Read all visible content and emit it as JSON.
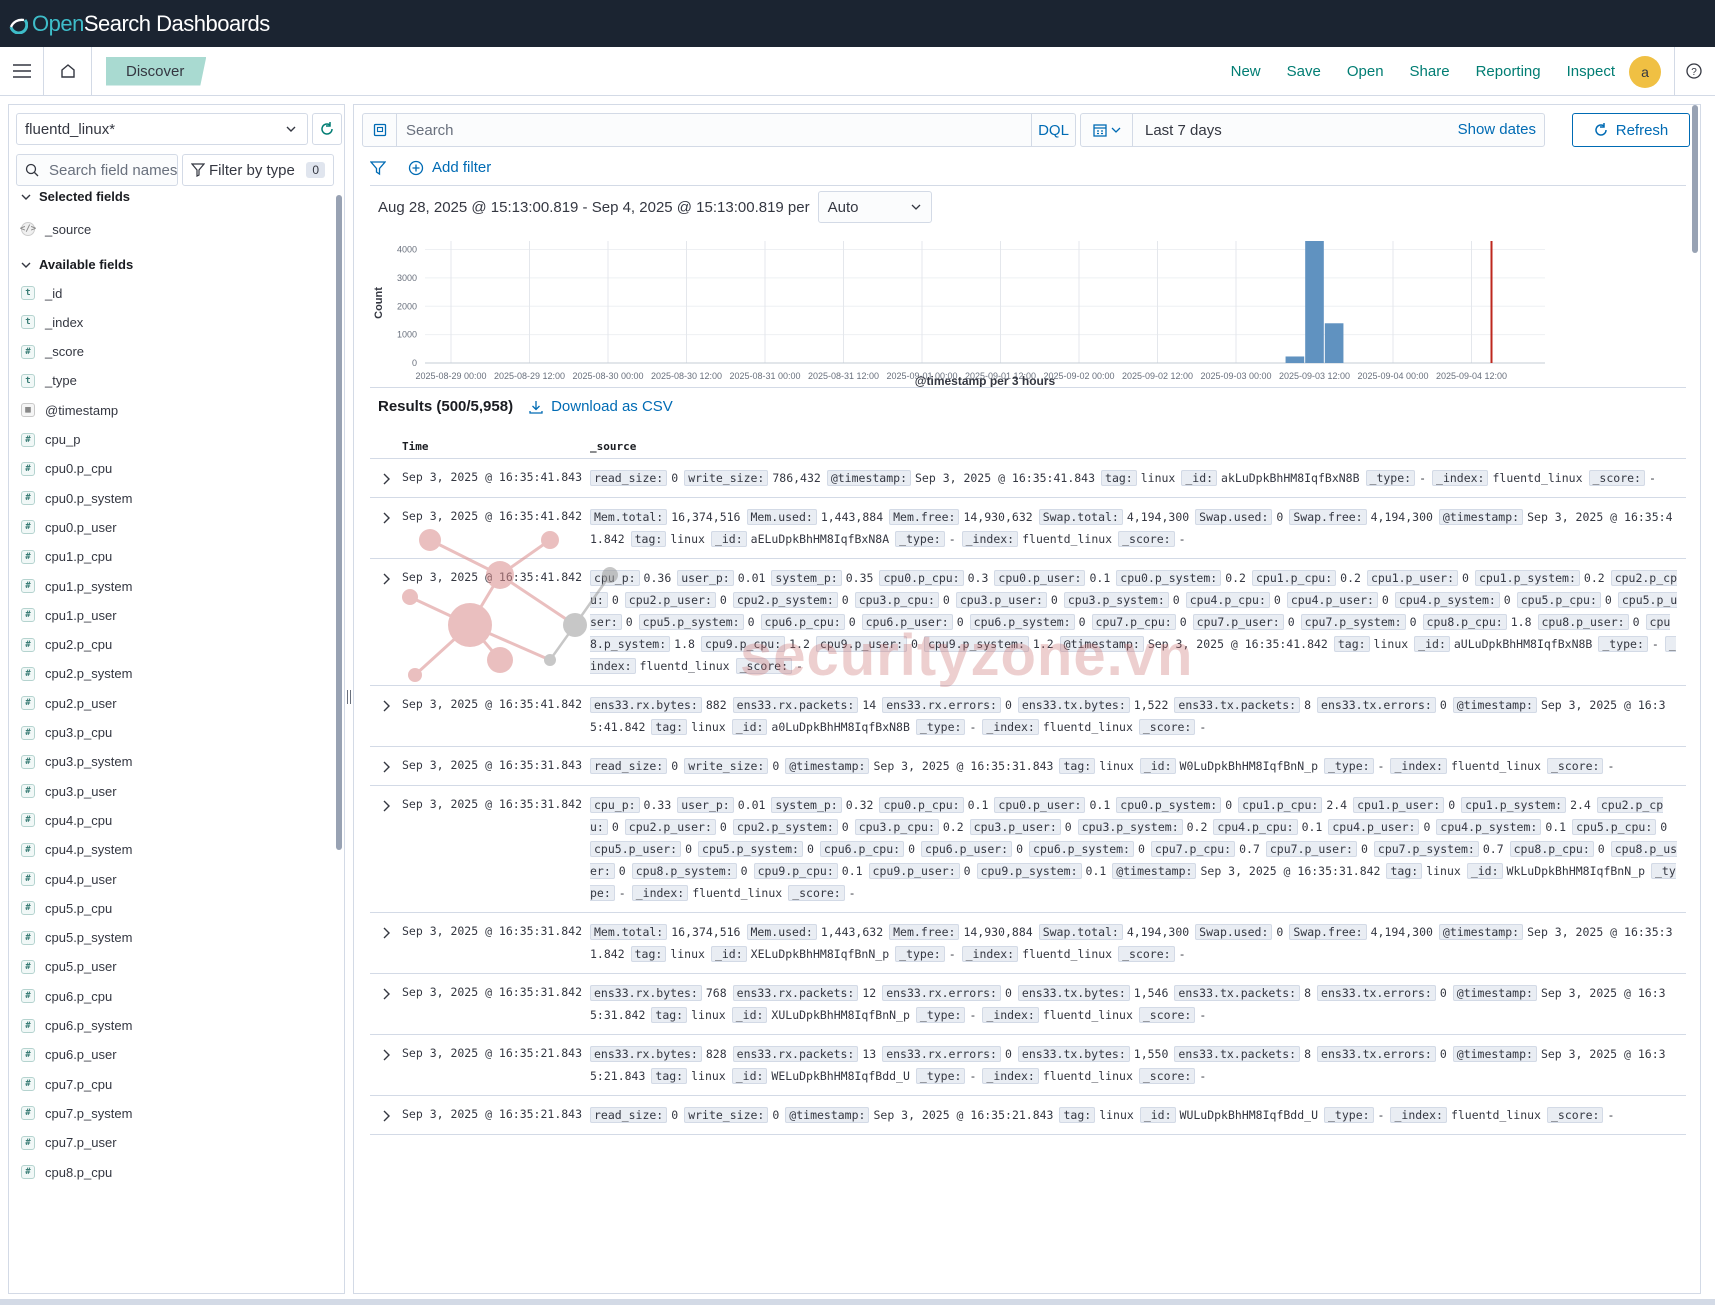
{
  "app": {
    "logo_open": "Open",
    "logo_rest": "Search Dashboards"
  },
  "nav": {
    "breadcrumb": "Discover",
    "links": [
      "New",
      "Save",
      "Open",
      "Share",
      "Reporting",
      "Inspect"
    ],
    "avatar": "a"
  },
  "sidebar": {
    "index_pattern": "fluentd_linux*",
    "search_placeholder": "Search field names",
    "filter_by_type": "Filter by type",
    "filter_count": "0",
    "selected_title": "Selected fields",
    "selected_fields": [
      {
        "name": "_source",
        "type": "source"
      }
    ],
    "available_title": "Available fields",
    "available_fields": [
      {
        "name": "_id",
        "type": "t"
      },
      {
        "name": "_index",
        "type": "t"
      },
      {
        "name": "_score",
        "type": "#"
      },
      {
        "name": "_type",
        "type": "t"
      },
      {
        "name": "@timestamp",
        "type": "date"
      },
      {
        "name": "cpu_p",
        "type": "#"
      },
      {
        "name": "cpu0.p_cpu",
        "type": "#"
      },
      {
        "name": "cpu0.p_system",
        "type": "#"
      },
      {
        "name": "cpu0.p_user",
        "type": "#"
      },
      {
        "name": "cpu1.p_cpu",
        "type": "#"
      },
      {
        "name": "cpu1.p_system",
        "type": "#"
      },
      {
        "name": "cpu1.p_user",
        "type": "#"
      },
      {
        "name": "cpu2.p_cpu",
        "type": "#"
      },
      {
        "name": "cpu2.p_system",
        "type": "#"
      },
      {
        "name": "cpu2.p_user",
        "type": "#"
      },
      {
        "name": "cpu3.p_cpu",
        "type": "#"
      },
      {
        "name": "cpu3.p_system",
        "type": "#"
      },
      {
        "name": "cpu3.p_user",
        "type": "#"
      },
      {
        "name": "cpu4.p_cpu",
        "type": "#"
      },
      {
        "name": "cpu4.p_system",
        "type": "#"
      },
      {
        "name": "cpu4.p_user",
        "type": "#"
      },
      {
        "name": "cpu5.p_cpu",
        "type": "#"
      },
      {
        "name": "cpu5.p_system",
        "type": "#"
      },
      {
        "name": "cpu5.p_user",
        "type": "#"
      },
      {
        "name": "cpu6.p_cpu",
        "type": "#"
      },
      {
        "name": "cpu6.p_system",
        "type": "#"
      },
      {
        "name": "cpu6.p_user",
        "type": "#"
      },
      {
        "name": "cpu7.p_cpu",
        "type": "#"
      },
      {
        "name": "cpu7.p_system",
        "type": "#"
      },
      {
        "name": "cpu7.p_user",
        "type": "#"
      },
      {
        "name": "cpu8.p_cpu",
        "type": "#"
      }
    ]
  },
  "query": {
    "placeholder": "Search",
    "language": "DQL",
    "time_range": "Last 7 days",
    "show_dates": "Show dates",
    "refresh": "Refresh",
    "add_filter": "Add filter"
  },
  "histogram": {
    "range_text": "Aug 28, 2025 @ 15:13:00.819 - Sep 4, 2025 @ 15:13:00.819 per",
    "interval": "Auto"
  },
  "chart_data": {
    "type": "bar",
    "title": "",
    "xlabel": "@timestamp per 3 hours",
    "ylabel": "Count",
    "ylim": [
      0,
      4300
    ],
    "yticks": [
      0,
      1000,
      2000,
      3000,
      4000
    ],
    "xticks": [
      "2025-08-29 00:00",
      "2025-08-29 12:00",
      "2025-08-30 00:00",
      "2025-08-30 12:00",
      "2025-08-31 00:00",
      "2025-08-31 12:00",
      "2025-09-01 00:00",
      "2025-09-01 12:00",
      "2025-09-02 00:00",
      "2025-09-02 12:00",
      "2025-09-03 00:00",
      "2025-09-03 12:00",
      "2025-09-04 00:00",
      "2025-09-04 12:00"
    ],
    "bars": [
      {
        "x": "2025-09-03 09:00",
        "value": 230
      },
      {
        "x": "2025-09-03 12:00",
        "value": 4300
      },
      {
        "x": "2025-09-03 15:00",
        "value": 1400
      }
    ],
    "color": "#6092c0",
    "now_marker_color": "#bd271e",
    "grid": true
  },
  "results": {
    "title": "Results (500/5,958)",
    "download": "Download as CSV",
    "col_time": "Time",
    "col_source": "_source",
    "rows": [
      {
        "time": "Sep 3, 2025 @ 16:35:41.843",
        "fields": [
          [
            "read_size:",
            "0"
          ],
          [
            "write_size:",
            "786,432"
          ],
          [
            "@timestamp:",
            "Sep 3, 2025 @ 16:35:41.843"
          ],
          [
            "tag:",
            "linux"
          ],
          [
            "_id:",
            "akLuDpkBhHM8IqfBxN8B"
          ],
          [
            "_type:",
            "-"
          ],
          [
            "_index:",
            "fluentd_linux"
          ],
          [
            "_score:",
            "-"
          ]
        ]
      },
      {
        "time": "Sep 3, 2025 @ 16:35:41.842",
        "fields": [
          [
            "Mem.total:",
            "16,374,516"
          ],
          [
            "Mem.used:",
            "1,443,884"
          ],
          [
            "Mem.free:",
            "14,930,632"
          ],
          [
            "Swap.total:",
            "4,194,300"
          ],
          [
            "Swap.used:",
            "0"
          ],
          [
            "Swap.free:",
            "4,194,300"
          ],
          [
            "@timestamp:",
            "Sep 3, 2025 @ 16:35:41.842"
          ],
          [
            "tag:",
            "linux"
          ],
          [
            "_id:",
            "aELuDpkBhHM8IqfBxN8A"
          ],
          [
            "_type:",
            "-"
          ],
          [
            "_index:",
            "fluentd_linux"
          ],
          [
            "_score:",
            "-"
          ]
        ]
      },
      {
        "time": "Sep 3, 2025 @ 16:35:41.842",
        "fields": [
          [
            "cpu_p:",
            "0.36"
          ],
          [
            "user_p:",
            "0.01"
          ],
          [
            "system_p:",
            "0.35"
          ],
          [
            "cpu0.p_cpu:",
            "0.3"
          ],
          [
            "cpu0.p_user:",
            "0.1"
          ],
          [
            "cpu0.p_system:",
            "0.2"
          ],
          [
            "cpu1.p_cpu:",
            "0.2"
          ],
          [
            "cpu1.p_user:",
            "0"
          ],
          [
            "cpu1.p_system:",
            "0.2"
          ],
          [
            "cpu2.p_cpu:",
            "0"
          ],
          [
            "cpu2.p_user:",
            "0"
          ],
          [
            "cpu2.p_system:",
            "0"
          ],
          [
            "cpu3.p_cpu:",
            "0"
          ],
          [
            "cpu3.p_user:",
            "0"
          ],
          [
            "cpu3.p_system:",
            "0"
          ],
          [
            "cpu4.p_cpu:",
            "0"
          ],
          [
            "cpu4.p_user:",
            "0"
          ],
          [
            "cpu4.p_system:",
            "0"
          ],
          [
            "cpu5.p_cpu:",
            "0"
          ],
          [
            "cpu5.p_user:",
            "0"
          ],
          [
            "cpu5.p_system:",
            "0"
          ],
          [
            "cpu6.p_cpu:",
            "0"
          ],
          [
            "cpu6.p_user:",
            "0"
          ],
          [
            "cpu6.p_system:",
            "0"
          ],
          [
            "cpu7.p_cpu:",
            "0"
          ],
          [
            "cpu7.p_user:",
            "0"
          ],
          [
            "cpu7.p_system:",
            "0"
          ],
          [
            "cpu8.p_cpu:",
            "1.8"
          ],
          [
            "cpu8.p_user:",
            "0"
          ],
          [
            "cpu8.p_system:",
            "1.8"
          ],
          [
            "cpu9.p_cpu:",
            "1.2"
          ],
          [
            "cpu9.p_user:",
            "0"
          ],
          [
            "cpu9.p_system:",
            "1.2"
          ],
          [
            "@timestamp:",
            "Sep 3, 2025 @ 16:35:41.842"
          ],
          [
            "tag:",
            "linux"
          ],
          [
            "_id:",
            "aULuDpkBhHM8IqfBxN8B"
          ],
          [
            "_type:",
            "-"
          ],
          [
            "_index:",
            "fluentd_linux"
          ],
          [
            "_score:",
            "-"
          ]
        ]
      },
      {
        "time": "Sep 3, 2025 @ 16:35:41.842",
        "fields": [
          [
            "ens33.rx.bytes:",
            "882"
          ],
          [
            "ens33.rx.packets:",
            "14"
          ],
          [
            "ens33.rx.errors:",
            "0"
          ],
          [
            "ens33.tx.bytes:",
            "1,522"
          ],
          [
            "ens33.tx.packets:",
            "8"
          ],
          [
            "ens33.tx.errors:",
            "0"
          ],
          [
            "@timestamp:",
            "Sep 3, 2025 @ 16:35:41.842"
          ],
          [
            "tag:",
            "linux"
          ],
          [
            "_id:",
            "a0LuDpkBhHM8IqfBxN8B"
          ],
          [
            "_type:",
            "-"
          ],
          [
            "_index:",
            "fluentd_linux"
          ],
          [
            "_score:",
            "-"
          ]
        ]
      },
      {
        "time": "Sep 3, 2025 @ 16:35:31.843",
        "fields": [
          [
            "read_size:",
            "0"
          ],
          [
            "write_size:",
            "0"
          ],
          [
            "@timestamp:",
            "Sep 3, 2025 @ 16:35:31.843"
          ],
          [
            "tag:",
            "linux"
          ],
          [
            "_id:",
            "W0LuDpkBhHM8IqfBnN_p"
          ],
          [
            "_type:",
            "-"
          ],
          [
            "_index:",
            "fluentd_linux"
          ],
          [
            "_score:",
            "-"
          ]
        ]
      },
      {
        "time": "Sep 3, 2025 @ 16:35:31.842",
        "fields": [
          [
            "cpu_p:",
            "0.33"
          ],
          [
            "user_p:",
            "0.01"
          ],
          [
            "system_p:",
            "0.32"
          ],
          [
            "cpu0.p_cpu:",
            "0.1"
          ],
          [
            "cpu0.p_user:",
            "0.1"
          ],
          [
            "cpu0.p_system:",
            "0"
          ],
          [
            "cpu1.p_cpu:",
            "2.4"
          ],
          [
            "cpu1.p_user:",
            "0"
          ],
          [
            "cpu1.p_system:",
            "2.4"
          ],
          [
            "cpu2.p_cpu:",
            "0"
          ],
          [
            "cpu2.p_user:",
            "0"
          ],
          [
            "cpu2.p_system:",
            "0"
          ],
          [
            "cpu3.p_cpu:",
            "0.2"
          ],
          [
            "cpu3.p_user:",
            "0"
          ],
          [
            "cpu3.p_system:",
            "0.2"
          ],
          [
            "cpu4.p_cpu:",
            "0.1"
          ],
          [
            "cpu4.p_user:",
            "0"
          ],
          [
            "cpu4.p_system:",
            "0.1"
          ],
          [
            "cpu5.p_cpu:",
            "0"
          ],
          [
            "cpu5.p_user:",
            "0"
          ],
          [
            "cpu5.p_system:",
            "0"
          ],
          [
            "cpu6.p_cpu:",
            "0"
          ],
          [
            "cpu6.p_user:",
            "0"
          ],
          [
            "cpu6.p_system:",
            "0"
          ],
          [
            "cpu7.p_cpu:",
            "0.7"
          ],
          [
            "cpu7.p_user:",
            "0"
          ],
          [
            "cpu7.p_system:",
            "0.7"
          ],
          [
            "cpu8.p_cpu:",
            "0"
          ],
          [
            "cpu8.p_user:",
            "0"
          ],
          [
            "cpu8.p_system:",
            "0"
          ],
          [
            "cpu9.p_cpu:",
            "0.1"
          ],
          [
            "cpu9.p_user:",
            "0"
          ],
          [
            "cpu9.p_system:",
            "0.1"
          ],
          [
            "@timestamp:",
            "Sep 3, 2025 @ 16:35:31.842"
          ],
          [
            "tag:",
            "linux"
          ],
          [
            "_id:",
            "WkLuDpkBhHM8IqfBnN_p"
          ],
          [
            "_type:",
            "-"
          ],
          [
            "_index:",
            "fluentd_linux"
          ],
          [
            "_score:",
            "-"
          ]
        ]
      },
      {
        "time": "Sep 3, 2025 @ 16:35:31.842",
        "fields": [
          [
            "Mem.total:",
            "16,374,516"
          ],
          [
            "Mem.used:",
            "1,443,632"
          ],
          [
            "Mem.free:",
            "14,930,884"
          ],
          [
            "Swap.total:",
            "4,194,300"
          ],
          [
            "Swap.used:",
            "0"
          ],
          [
            "Swap.free:",
            "4,194,300"
          ],
          [
            "@timestamp:",
            "Sep 3, 2025 @ 16:35:31.842"
          ],
          [
            "tag:",
            "linux"
          ],
          [
            "_id:",
            "XELuDpkBhHM8IqfBnN_p"
          ],
          [
            "_type:",
            "-"
          ],
          [
            "_index:",
            "fluentd_linux"
          ],
          [
            "_score:",
            "-"
          ]
        ]
      },
      {
        "time": "Sep 3, 2025 @ 16:35:31.842",
        "fields": [
          [
            "ens33.rx.bytes:",
            "768"
          ],
          [
            "ens33.rx.packets:",
            "12"
          ],
          [
            "ens33.rx.errors:",
            "0"
          ],
          [
            "ens33.tx.bytes:",
            "1,546"
          ],
          [
            "ens33.tx.packets:",
            "8"
          ],
          [
            "ens33.tx.errors:",
            "0"
          ],
          [
            "@timestamp:",
            "Sep 3, 2025 @ 16:35:31.842"
          ],
          [
            "tag:",
            "linux"
          ],
          [
            "_id:",
            "XULuDpkBhHM8IqfBnN_p"
          ],
          [
            "_type:",
            "-"
          ],
          [
            "_index:",
            "fluentd_linux"
          ],
          [
            "_score:",
            "-"
          ]
        ]
      },
      {
        "time": "Sep 3, 2025 @ 16:35:21.843",
        "fields": [
          [
            "ens33.rx.bytes:",
            "828"
          ],
          [
            "ens33.rx.packets:",
            "13"
          ],
          [
            "ens33.rx.errors:",
            "0"
          ],
          [
            "ens33.tx.bytes:",
            "1,550"
          ],
          [
            "ens33.tx.packets:",
            "8"
          ],
          [
            "ens33.tx.errors:",
            "0"
          ],
          [
            "@timestamp:",
            "Sep 3, 2025 @ 16:35:21.843"
          ],
          [
            "tag:",
            "linux"
          ],
          [
            "_id:",
            "WELuDpkBhHM8IqfBdd_U"
          ],
          [
            "_type:",
            "-"
          ],
          [
            "_index:",
            "fluentd_linux"
          ],
          [
            "_score:",
            "-"
          ]
        ]
      },
      {
        "time": "Sep 3, 2025 @ 16:35:21.843",
        "fields": [
          [
            "read_size:",
            "0"
          ],
          [
            "write_size:",
            "0"
          ],
          [
            "@timestamp:",
            "Sep 3, 2025 @ 16:35:21.843"
          ],
          [
            "tag:",
            "linux"
          ],
          [
            "_id:",
            "WULuDpkBhHM8IqfBdd_U"
          ],
          [
            "_type:",
            "-"
          ],
          [
            "_index:",
            "fluentd_linux"
          ],
          [
            "_score:",
            "-"
          ]
        ]
      }
    ]
  },
  "watermark": "securityzone.vn",
  "colors": {
    "topbar": "#1b2431",
    "link": "#006bb4",
    "nav_link": "#017d73",
    "breadcrumb": "#a9dad1",
    "avatar": "#f0c043"
  }
}
